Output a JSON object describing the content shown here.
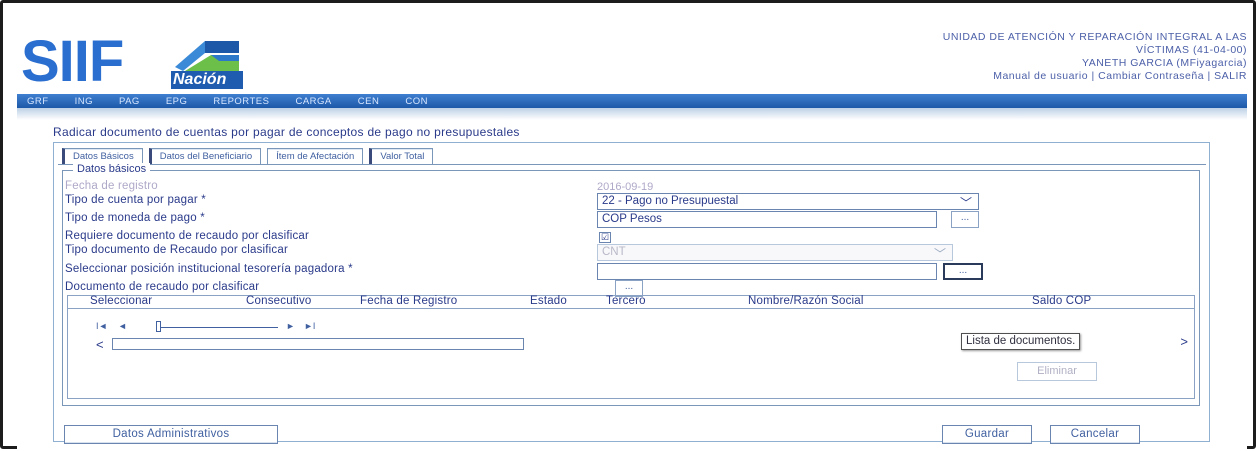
{
  "header": {
    "logo_text": "SIIF",
    "logo_subtext": "Nación",
    "entity_line1": "UNIDAD DE ATENCIÓN Y REPARACIÓN INTEGRAL A LAS",
    "entity_line2": "VÍCTIMAS (41-04-00)",
    "user_line": "YANETH GARCIA (MFiyagarcia)",
    "link_manual": "Manual de usuario",
    "link_sep1": "|",
    "link_change_password": "Cambiar Contraseña",
    "link_sep2": "|",
    "link_exit": "SALIR"
  },
  "nav": {
    "items": [
      "GRF",
      "ING",
      "PAG",
      "EPG",
      "REPORTES",
      "CARGA",
      "CEN",
      "CON"
    ]
  },
  "page": {
    "title": "Radicar documento de cuentas por pagar de conceptos de pago no presupuestales"
  },
  "tabs": [
    "Datos Básicos",
    "Datos del Beneficiario",
    "Ítem de Afectación",
    "Valor Total"
  ],
  "form": {
    "legend": "Datos básicos",
    "fecha_registro_label": "Fecha de registro",
    "fecha_registro_value": "2016-09-19",
    "tipo_cuenta_label": "Tipo de cuenta por pagar *",
    "tipo_cuenta_value": "22 - Pago no Presupuestal",
    "tipo_moneda_label": "Tipo de moneda de pago *",
    "tipo_moneda_value": "COP Pesos",
    "dots": "...",
    "requiere_doc_label": "Requiere documento de recaudo por clasificar",
    "requiere_doc_checked": "☑",
    "tipo_doc_recaudo_label": "Tipo documento de Recaudo por clasificar",
    "tipo_doc_recaudo_value": "CNT",
    "posicion_label": "Seleccionar posición institucional tesorería pagadora *",
    "posicion_value": "",
    "documento_recaudo_label": "Documento de recaudo por clasificar"
  },
  "grid": {
    "columns": [
      "Seleccionar",
      "Consecutivo",
      "Fecha de Registro",
      "Estado",
      "Tercero",
      "Nombre/Razón Social",
      "Saldo COP"
    ],
    "pager_first": "I◄",
    "pager_prev": "◄",
    "pager_next": "►",
    "pager_last": "►I",
    "scroll_left": "<",
    "scroll_right": ">",
    "tooltip": "Lista de documentos.",
    "eliminar": "Eliminar"
  },
  "footer": {
    "datos_administrativos": "Datos Administrativos",
    "guardar": "Guardar",
    "cancelar": "Cancelar"
  }
}
